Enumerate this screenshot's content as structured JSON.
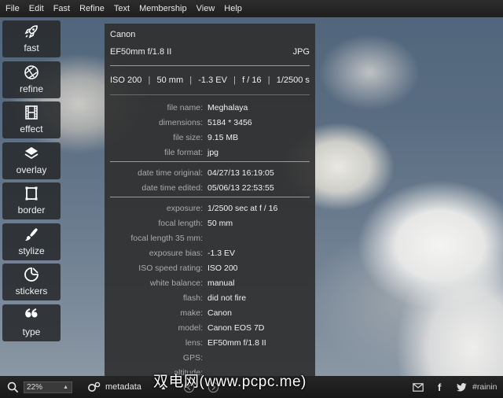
{
  "menu": [
    "File",
    "Edit",
    "Fast",
    "Refine",
    "Text",
    "Membership",
    "View",
    "Help"
  ],
  "tools": [
    {
      "label": "fast",
      "icon": "rocket-icon"
    },
    {
      "label": "refine",
      "icon": "aperture-icon"
    },
    {
      "label": "effect",
      "icon": "film-icon"
    },
    {
      "label": "overlay",
      "icon": "layers-icon"
    },
    {
      "label": "border",
      "icon": "frame-icon"
    },
    {
      "label": "stylize",
      "icon": "brush-icon"
    },
    {
      "label": "stickers",
      "icon": "sticker-icon"
    },
    {
      "label": "type",
      "icon": "quote-icon"
    }
  ],
  "panel": {
    "make": "Canon",
    "lens": "EF50mm f/1.8 II",
    "format_badge": "JPG",
    "specs": {
      "iso": "ISO 200",
      "focal": "50 mm",
      "ev": "-1.3 EV",
      "fstop": "f / 16",
      "shutter": "1/2500 s"
    },
    "file": [
      {
        "k": "file name:",
        "v": "Meghalaya"
      },
      {
        "k": "dimensions:",
        "v": "5184 * 3456"
      },
      {
        "k": "file size:",
        "v": "9.15 MB"
      },
      {
        "k": "file format:",
        "v": "jpg"
      }
    ],
    "dates": [
      {
        "k": "date time original:",
        "v": "04/27/13 16:19:05"
      },
      {
        "k": "date time edited:",
        "v": "05/06/13 22:53:55"
      }
    ],
    "exif": [
      {
        "k": "exposure:",
        "v": "1/2500 sec at f / 16"
      },
      {
        "k": "focal length:",
        "v": "50 mm"
      },
      {
        "k": "focal length 35 mm:",
        "v": ""
      },
      {
        "k": "exposure bias:",
        "v": "-1.3 EV"
      },
      {
        "k": "ISO speed rating:",
        "v": "ISO 200"
      },
      {
        "k": "white balance:",
        "v": "manual"
      },
      {
        "k": "flash:",
        "v": "did not fire"
      },
      {
        "k": "make:",
        "v": "Canon"
      },
      {
        "k": "model:",
        "v": "Canon EOS 7D"
      },
      {
        "k": "lens:",
        "v": "EF50mm f/1.8 II"
      },
      {
        "k": "GPS:",
        "v": ""
      },
      {
        "k": "altitude:",
        "v": ""
      }
    ]
  },
  "bottom": {
    "zoom": "22%",
    "metadata_label": "metadata",
    "share_text": "#rainin"
  },
  "watermark": "双电网(www.pcpc.me)"
}
